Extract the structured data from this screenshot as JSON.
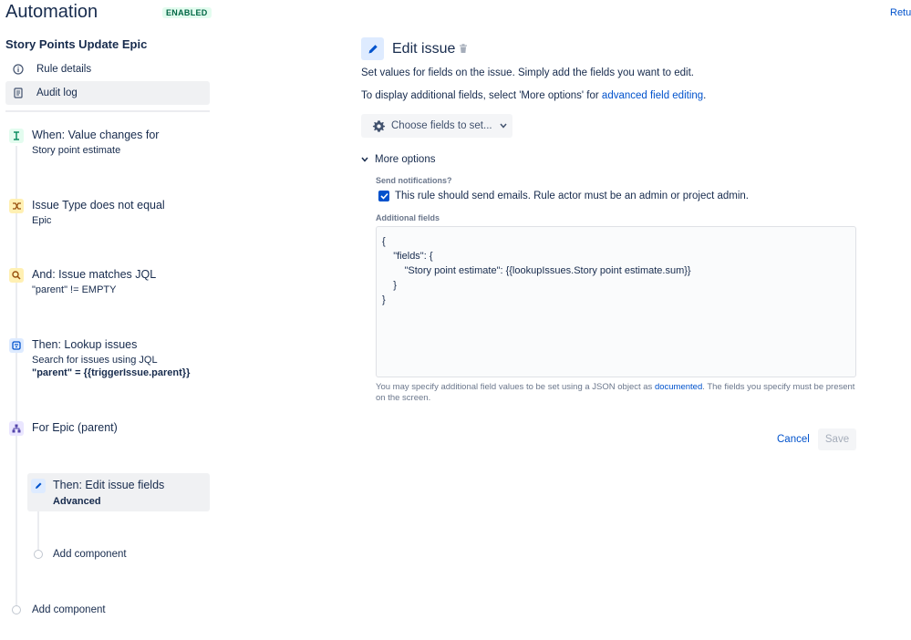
{
  "header": {
    "title": "Automation",
    "status_badge": "ENABLED",
    "return_link": "Retu"
  },
  "sidebar": {
    "rule_name": "Story Points Update Epic",
    "nav": [
      {
        "label": "Rule details",
        "icon": "info-icon"
      },
      {
        "label": "Audit log",
        "icon": "document-icon"
      }
    ],
    "components": [
      {
        "title": "When: Value changes for",
        "subtitle": "Story point estimate",
        "icon": "trigger-icon"
      },
      {
        "title": "Issue Type does not equal",
        "subtitle": "Epic",
        "icon": "condition-shuffle-icon"
      },
      {
        "title": "And: Issue matches JQL",
        "subtitle": "\"parent\" != EMPTY",
        "icon": "search-icon"
      },
      {
        "title": "Then: Lookup issues",
        "subtitle": "Search for issues using JQL",
        "subtitle2": "\"parent\" = {{triggerIssue.parent}}",
        "icon": "lookup-icon"
      },
      {
        "title": "For Epic (parent)",
        "icon": "branch-icon"
      },
      {
        "title": "Then: Edit issue fields",
        "subtitle": "Advanced",
        "icon": "pencil-icon"
      }
    ],
    "add_component_inner": "Add component",
    "add_component_outer": "Add component"
  },
  "editor": {
    "title": "Edit issue",
    "description1": "Set values for fields on the issue. Simply add the fields you want to edit.",
    "description2_prefix": "To display additional fields, select 'More options' for ",
    "description2_link": "advanced field editing",
    "description2_suffix": ".",
    "choose_fields_label": "Choose fields to set...",
    "more_options_label": "More options",
    "send_notifications_label": "Send notifications?",
    "send_notifications_checked": true,
    "send_notifications_text": "This rule should send emails. Rule actor must be an admin or project admin.",
    "additional_fields_label": "Additional fields",
    "additional_fields_lines": [
      "{",
      "    \"fields\": {",
      "        \"Story point estimate\": {{lookupIssues.Story point estimate.sum}}",
      "    }",
      "}"
    ],
    "help_prefix": "You may specify additional field values to be set using a JSON object as ",
    "help_link": "documented",
    "help_suffix": ". The fields you specify must be present on the screen.",
    "cancel_label": "Cancel",
    "save_label": "Save"
  },
  "colors": {
    "accent": "#0052cc",
    "badge_green": "#006644",
    "selected_bg": "#f0f1f3"
  }
}
